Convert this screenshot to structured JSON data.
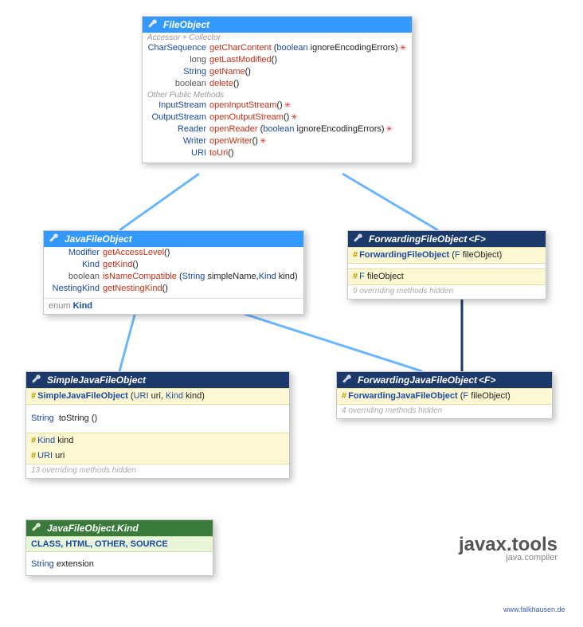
{
  "package": {
    "name": "javax.tools",
    "module": "java.compiler"
  },
  "credit": "www.falkhausen.de",
  "fileObject": {
    "title": "FileObject",
    "sectAccessor": "Accessor + Collector",
    "sectOther": "Other Public Methods",
    "methods": {
      "m1": {
        "rt": "CharSequence",
        "name": "getCharContent",
        "params": "(boolean ignoreEncodingErrors)",
        "throws": "✳"
      },
      "m2": {
        "rt": "long",
        "name": "getLastModified",
        "params": "()"
      },
      "m3": {
        "rt": "String",
        "name": "getName",
        "params": "()"
      },
      "m4": {
        "rt": "boolean",
        "name": "delete",
        "params": "()"
      },
      "m5": {
        "rt": "InputStream",
        "name": "openInputStream",
        "params": "()",
        "throws": "✳"
      },
      "m6": {
        "rt": "OutputStream",
        "name": "openOutputStream",
        "params": "()",
        "throws": "✳"
      },
      "m7": {
        "rt": "Reader",
        "name": "openReader",
        "params": "(boolean ignoreEncodingErrors)",
        "throws": "✳"
      },
      "m8": {
        "rt": "Writer",
        "name": "openWriter",
        "params": "()",
        "throws": "✳"
      },
      "m9": {
        "rt": "URI",
        "name": "toUri",
        "params": "()"
      }
    }
  },
  "javaFileObject": {
    "title": "JavaFileObject",
    "methods": {
      "m1": {
        "rt": "Modifier",
        "name": "getAccessLevel",
        "params": "()"
      },
      "m2": {
        "rt": "Kind",
        "name": "getKind",
        "params": "()"
      },
      "m3": {
        "rt": "boolean",
        "name": "isNameCompatible",
        "params_pt1": "String",
        "params_pn1": "simpleName",
        "params_pt2": "Kind",
        "params_pn2": "kind"
      },
      "m4": {
        "rt": "NestingKind",
        "name": "getNestingKind",
        "params": "()"
      }
    },
    "enumRow": "enum Kind"
  },
  "forwardingFileObject": {
    "title": "ForwardingFileObject",
    "generic": "<F>",
    "ctor": {
      "name": "ForwardingFileObject",
      "params_pt": "F",
      "params_pn": "fileObject"
    },
    "field": {
      "type": "F",
      "name": "fileObject"
    },
    "hidden": "9 overriding methods hidden"
  },
  "simpleJavaFileObject": {
    "title": "SimpleJavaFileObject",
    "ctor": {
      "name": "SimpleJavaFileObject",
      "params_pt1": "URI",
      "params_pn1": "uri",
      "params_pt2": "Kind",
      "params_pn2": "kind"
    },
    "m_toString": {
      "rt": "String",
      "name": "toString",
      "params": "()"
    },
    "f1": {
      "type": "Kind",
      "name": "kind"
    },
    "f2": {
      "type": "URI",
      "name": "uri"
    },
    "hidden": "13 overriding methods hidden"
  },
  "forwardingJavaFileObject": {
    "title": "ForwardingJavaFileObject",
    "generic": "<F>",
    "ctor": {
      "name": "ForwardingJavaFileObject",
      "params_pt": "F",
      "params_pn": "fileObject"
    },
    "hidden": "4 overriding methods hidden"
  },
  "kindEnum": {
    "title": "JavaFileObject.Kind",
    "values": "CLASS, HTML, OTHER, SOURCE",
    "field": {
      "rt": "String",
      "name": "extension"
    }
  }
}
